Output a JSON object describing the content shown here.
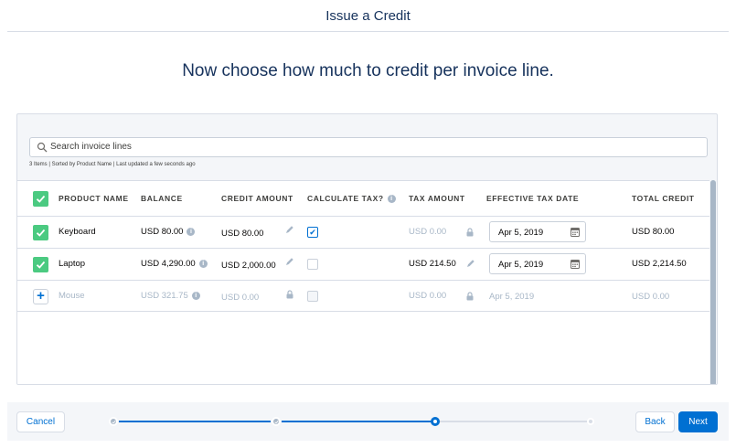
{
  "header": {
    "title": "Issue a Credit"
  },
  "subtitle": "Now choose how much to credit per invoice line.",
  "search": {
    "placeholder": "Search invoice lines",
    "meta": "3 Items | Sorted by Product Name | Last updated a few seconds ago"
  },
  "columns": {
    "product_name": "PRODUCT NAME",
    "balance": "BALANCE",
    "credit_amount": "CREDIT AMOUNT",
    "calculate_tax": "CALCULATE TAX?",
    "tax_amount": "TAX AMOUNT",
    "effective_tax_date": "EFFECTIVE TAX DATE",
    "total_credit": "TOTAL CREDIT"
  },
  "rows": [
    {
      "selected": true,
      "product": "Keyboard",
      "balance": "USD 80.00",
      "credit_amount": "USD 80.00",
      "calculate_tax": true,
      "tax_amount": "USD 0.00",
      "effective_tax_date": "Apr 5, 2019",
      "total_credit": "USD 80.00"
    },
    {
      "selected": true,
      "product": "Laptop",
      "balance": "USD 4,290.00",
      "credit_amount": "USD 2,000.00",
      "calculate_tax": false,
      "tax_amount": "USD 214.50",
      "effective_tax_date": "Apr 5, 2019",
      "total_credit": "USD 2,214.50"
    },
    {
      "selected": false,
      "product": "Mouse",
      "balance": "USD 321.75",
      "credit_amount": "USD 0.00",
      "calculate_tax": false,
      "tax_amount": "USD 0.00",
      "effective_tax_date": "Apr 5, 2019",
      "total_credit": "USD 0.00"
    }
  ],
  "footer": {
    "cancel_label": "Cancel",
    "back_label": "Back",
    "next_label": "Next",
    "progress": {
      "steps": 4,
      "current_step": 3,
      "completed_steps": 2
    }
  },
  "colors": {
    "accent": "#0070d2",
    "success": "#4bca81",
    "muted": "#a8b7c7"
  },
  "icons": {
    "search": "search-icon",
    "info": "info-icon",
    "edit": "pencil-icon",
    "lock": "lock-icon",
    "calendar": "calendar-icon",
    "check": "check-icon",
    "add": "plus-icon"
  }
}
